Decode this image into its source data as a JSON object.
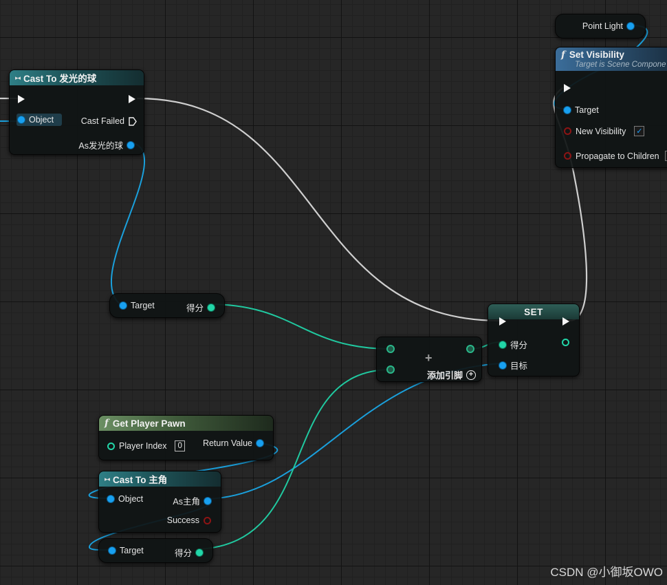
{
  "cast_glow": {
    "title": "Cast To 发光的球",
    "object": "Object",
    "cast_failed": "Cast Failed",
    "as_output": "As发光的球"
  },
  "target_score_top": {
    "target": "Target",
    "score": "得分"
  },
  "add_node": {
    "add_pin": "添加引脚"
  },
  "set_node": {
    "title": "SET",
    "score": "得分",
    "target": "目标"
  },
  "point_light": {
    "label": "Point Light"
  },
  "set_visibility": {
    "title": "Set Visibility",
    "subtitle": "Target is Scene Compone",
    "target": "Target",
    "new_visibility": "New Visibility",
    "new_visibility_checked": true,
    "propagate": "Propagate to Children"
  },
  "get_player_pawn": {
    "title": "Get Player Pawn",
    "player_index": "Player Index",
    "player_index_value": "0",
    "return_value": "Return Value"
  },
  "cast_main": {
    "title": "Cast To 主角",
    "object": "Object",
    "as_output": "As主角",
    "success": "Success"
  },
  "target_score_bottom": {
    "target": "Target",
    "score": "得分"
  },
  "watermark": "CSDN @小御坂OWO",
  "colors": {
    "exec": "#cfcfcf",
    "object": "#18a0f0",
    "integer": "#22d6a8",
    "boolean": "#8c1414",
    "cast_header": "#2f7f86",
    "function_header": "#6b8f63",
    "setvis_header": "#3b6d9a"
  }
}
